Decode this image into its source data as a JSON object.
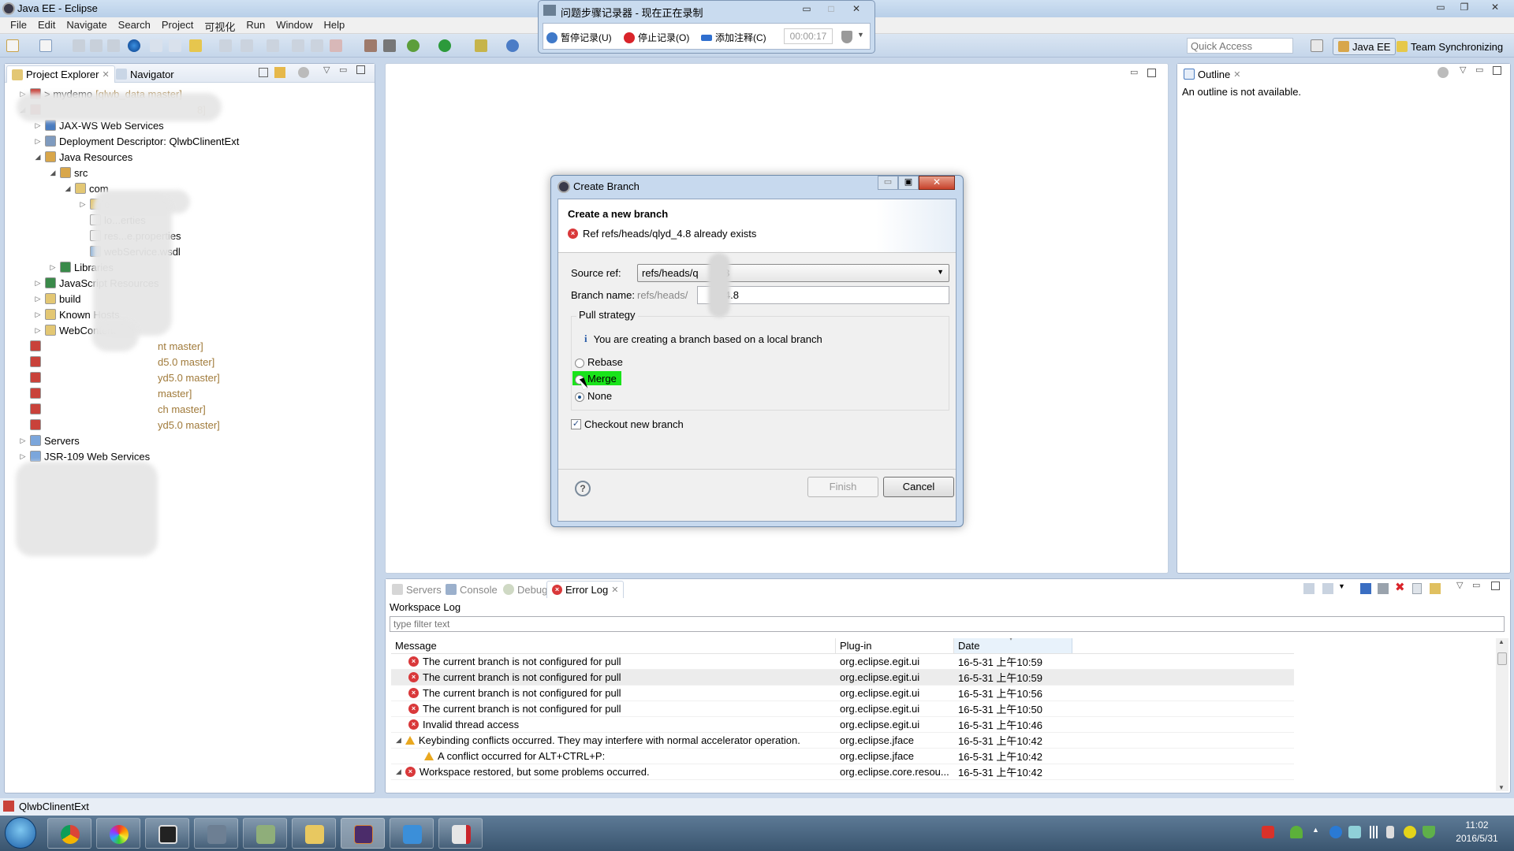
{
  "window": {
    "title": "Java EE - Eclipse"
  },
  "menubar": [
    "File",
    "Edit",
    "Navigate",
    "Search",
    "Project",
    "可视化",
    "Run",
    "Window",
    "Help"
  ],
  "toolbar": {
    "quick_access_placeholder": "Quick Access",
    "perspectives": [
      {
        "label": "Java EE",
        "active": true
      },
      {
        "label": "Team Synchronizing",
        "active": false
      }
    ]
  },
  "recorder": {
    "title": "问题步骤记录器 - 现在正在录制",
    "pause": "暂停记录(U)",
    "stop": "停止记录(O)",
    "comment": "添加注释(C)",
    "timer": "00:00:17"
  },
  "project_explorer": {
    "tabs": [
      {
        "label": "Project Explorer",
        "active": true
      },
      {
        "label": "Navigator",
        "active": false
      }
    ],
    "tree": [
      {
        "label": "> mydemo",
        "git": "[qlwb_data master]",
        "level": 0,
        "expanded": false
      },
      {
        "label": "",
        "git": "8]",
        "level": 0,
        "expanded": true
      },
      {
        "label": "JAX-WS Web Services",
        "level": 1,
        "expanded": false
      },
      {
        "label": "Deployment Descriptor: QlwbClinentExt",
        "level": 1,
        "expanded": false
      },
      {
        "label": "Java Resources",
        "level": 1,
        "expanded": true
      },
      {
        "label": "src",
        "level": 2,
        "expanded": true
      },
      {
        "label": "com",
        "level": 3,
        "expanded": true
      },
      {
        "label": "e",
        "level": 4,
        "expanded": false
      },
      {
        "label": "lo...erties",
        "level": 4
      },
      {
        "label": "res...e.properties",
        "level": 4
      },
      {
        "label": "webService.wsdl",
        "level": 4
      },
      {
        "label": "Libraries",
        "level": 2,
        "expanded": false
      },
      {
        "label": "JavaScript Resources",
        "level": 1,
        "expanded": false
      },
      {
        "label": "build",
        "level": 1,
        "expanded": false
      },
      {
        "label": "Known Hosts",
        "level": 1,
        "expanded": false
      },
      {
        "label": "WebContent",
        "level": 1,
        "expanded": false
      },
      {
        "label": "",
        "git": "nt master]",
        "level": 0
      },
      {
        "label": "",
        "git": "d5.0 master]",
        "level": 0
      },
      {
        "label": "",
        "git": "yd5.0 master]",
        "level": 0
      },
      {
        "label": "",
        "git": "master]",
        "level": 0
      },
      {
        "label": "",
        "git": "ch master]",
        "level": 0
      },
      {
        "label": "",
        "git": "yd5.0 master]",
        "level": 0
      },
      {
        "label": "Servers",
        "level": 0,
        "expanded": false
      },
      {
        "label": "JSR-109 Web Services",
        "level": 0,
        "expanded": false
      }
    ]
  },
  "outline": {
    "tab": "Outline",
    "message": "An outline is not available."
  },
  "dialog": {
    "title": "Create Branch",
    "heading": "Create a new branch",
    "error": "Ref refs/heads/qlyd_4.8 already exists",
    "source_ref_label": "Source ref:",
    "source_ref_value": "refs/heads/q      4.8",
    "branch_name_label": "Branch name:",
    "branch_name_prefix": "refs/heads/",
    "branch_name_value": "      _4.8",
    "pull_strategy_label": "Pull strategy",
    "info": "You are creating a branch based on a local branch",
    "options": [
      {
        "label": "Rebase",
        "selected": false
      },
      {
        "label": "Merge",
        "selected": false,
        "highlighted": true
      },
      {
        "label": "None",
        "selected": true
      }
    ],
    "checkout_label": "Checkout new branch",
    "checkout_checked": true,
    "finish": "Finish",
    "cancel": "Cancel"
  },
  "bottom": {
    "tabs": [
      {
        "label": "Servers"
      },
      {
        "label": "Console"
      },
      {
        "label": "Debug"
      },
      {
        "label": "Error Log",
        "active": true
      }
    ],
    "log_title": "Workspace Log",
    "filter_placeholder": "type filter text",
    "columns": [
      "Message",
      "Plug-in",
      "Date"
    ],
    "rows": [
      {
        "type": "error",
        "message": "The current branch is not configured for pull",
        "plugin": "org.eclipse.egit.ui",
        "date": "16-5-31 上午10:59"
      },
      {
        "type": "error",
        "message": "The current branch is not configured for pull",
        "plugin": "org.eclipse.egit.ui",
        "date": "16-5-31 上午10:59",
        "selected": true
      },
      {
        "type": "error",
        "message": "The current branch is not configured for pull",
        "plugin": "org.eclipse.egit.ui",
        "date": "16-5-31 上午10:56"
      },
      {
        "type": "error",
        "message": "The current branch is not configured for pull",
        "plugin": "org.eclipse.egit.ui",
        "date": "16-5-31 上午10:50"
      },
      {
        "type": "error",
        "message": "Invalid thread access",
        "plugin": "org.eclipse.egit.ui",
        "date": "16-5-31 上午10:46"
      },
      {
        "type": "warning",
        "message": "Keybinding conflicts occurred.  They may interfere with normal accelerator operation.",
        "plugin": "org.eclipse.jface",
        "date": "16-5-31 上午10:42",
        "expanded": true
      },
      {
        "type": "warning",
        "message": "A conflict occurred for ALT+CTRL+P:",
        "plugin": "org.eclipse.jface",
        "date": "16-5-31 上午10:42",
        "child": true
      },
      {
        "type": "error",
        "message": "Workspace restored, but some problems occurred.",
        "plugin": "org.eclipse.core.resou...",
        "date": "16-5-31 上午10:42",
        "expanded": true
      }
    ]
  },
  "statusbar": {
    "selection": "QlwbClinentExt"
  },
  "taskbar": {
    "time": "11:02",
    "date": "2016/5/31"
  }
}
